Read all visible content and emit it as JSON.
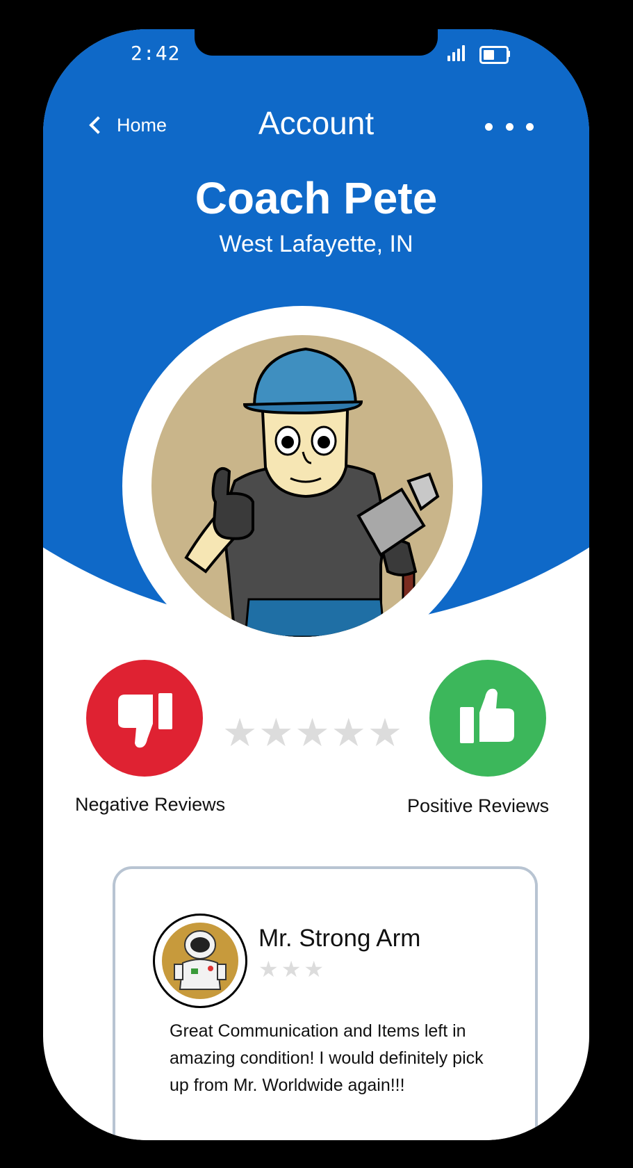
{
  "status_bar": {
    "time": "2:42"
  },
  "header": {
    "back_label": "Home",
    "title": "Account"
  },
  "profile": {
    "name": "Coach Pete",
    "location": "West Lafayette, IN"
  },
  "rating": {
    "stars_total": 5,
    "stars_filled": 0
  },
  "reviews": {
    "negative_label": "Negative Reviews",
    "positive_label": "Positive Reviews"
  },
  "review": {
    "reviewer_name": "Mr. Strong Arm",
    "stars_total": 3,
    "stars_filled": 0,
    "text": "Great Communication and Items left in amazing condition! I would definitely pick up from Mr. Worldwide again!!!"
  },
  "colors": {
    "header_blue": "#0f69c8",
    "negative_red": "#df2232",
    "positive_green": "#3cb75b",
    "star_gray": "#dcdcdc"
  }
}
